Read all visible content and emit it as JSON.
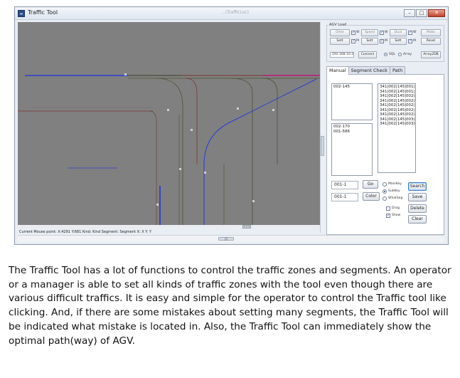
{
  "window": {
    "title": "Traffic Tool",
    "ghost_title": "…(TrafficLoc)",
    "controls": {
      "minimize": "–",
      "maximize": "□",
      "close": "✕"
    }
  },
  "agv_load": {
    "label": "AGV Load",
    "buttons": {
      "dime": "Dime",
      "speed": "Speed",
      "dual": "Dual",
      "make": "Make",
      "set1": "Sett",
      "set2": "Sett",
      "set3": "Sett",
      "reset": "Reset",
      "connect": "Connect",
      "array_db": "Array2DB"
    },
    "checks": {
      "c1": "W",
      "c2": "M",
      "c3": "W",
      "c4": "M",
      "c5": "W",
      "c6": "M"
    },
    "ip": "192.168.10.2",
    "radios": {
      "sql": "SQL",
      "array": "Array"
    }
  },
  "tabs": [
    "Manual",
    "Segment Check",
    "Path"
  ],
  "manual": {
    "list_top_left": [
      "002-145"
    ],
    "list_bottom_left": [
      "002-170",
      "001-586"
    ],
    "list_right": [
      "341|002|145|001|590",
      "341|002|145|001|599",
      "341|002|145|002|88",
      "341|002|145|002|97",
      "341|002|145|002|111",
      "341|002|145|002|183",
      "341|002|145|002|200",
      "341|002|145|003|40",
      "341|002|145|003|69"
    ],
    "input1": "001-1",
    "input2": "001-1",
    "go_button": "Go",
    "color_button": "Color",
    "radio_mainkey": "MainKey",
    "radio_subkey": "SubKey",
    "radio_whatseg": "WhatSeg",
    "check_drag": "Drag",
    "check_show": "Show",
    "search_button": "Search",
    "save_button": "Save",
    "delete_button": "Delete",
    "clear_button": "Clear"
  },
  "statusbar": "Current Mouse point: X:4291 Y:681 Kind: Kind Segment: Segment X: X Y: Y",
  "scroll": {
    "h_thumb": "<<<",
    "bottom_thumb": "|||"
  },
  "description": "The Traffic Tool has a lot of functions to control the traffic zones and segments. An operator or a manager is able to set all kinds of traffic zones with the tool even though there are various difficult traffics. It is easy and simple for the operator to control the Traffic tool like clicking. And, if there are some mistakes about setting many segments, the Traffic Tool will be indicated what mistake is located in. Also, the Traffic Tool can immediately show the optimal path(way) of AGV."
}
